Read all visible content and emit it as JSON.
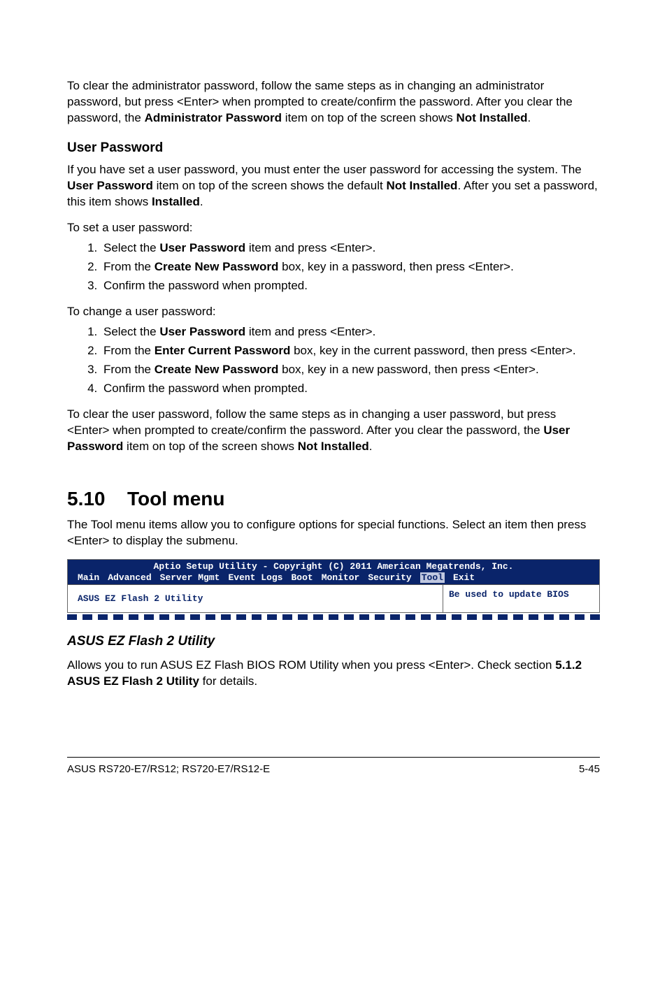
{
  "para1_a": "To clear the administrator password, follow the same steps as in changing an administrator password, but press <Enter> when prompted to create/confirm the password. After you clear the password, the ",
  "para1_b": "Administrator Password",
  "para1_c": " item on top of the screen shows ",
  "para1_d": "Not Installed",
  "para1_e": ".",
  "user_password_heading": "User Password",
  "para2_a": "If you have set a user password, you must enter the user password for accessing the system. The ",
  "para2_b": "User Password",
  "para2_c": " item on top of the screen shows the default ",
  "para2_d": "Not Installed",
  "para2_e": ". After you set a password, this item shows ",
  "para2_f": "Installed",
  "para2_g": ".",
  "lead_set": "To set a user password:",
  "set_li1_a": "Select the ",
  "set_li1_b": "User Password",
  "set_li1_c": " item and press <Enter>.",
  "set_li2_a": "From the ",
  "set_li2_b": "Create New Password",
  "set_li2_c": " box, key in a password, then press <Enter>.",
  "set_li3": "Confirm the password when prompted.",
  "lead_change": "To change a user password:",
  "chg_li1_a": "Select the ",
  "chg_li1_b": "User Password",
  "chg_li1_c": " item and press <Enter>.",
  "chg_li2_a": "From the ",
  "chg_li2_b": "Enter Current Password",
  "chg_li2_c": " box, key in the current password, then press <Enter>.",
  "chg_li3_a": "From the ",
  "chg_li3_b": "Create New Password",
  "chg_li3_c": " box, key in a new password, then press <Enter>.",
  "chg_li4": "Confirm the password when prompted.",
  "para3_a": "To clear the user password, follow the same steps as in changing a user password, but press <Enter> when prompted to create/confirm the password. After you clear the password, the ",
  "para3_b": "User Password",
  "para3_c": " item on top of the screen shows ",
  "para3_d": "Not Installed",
  "para3_e": ".",
  "h1_num": "5.10",
  "h1_text": "Tool menu",
  "para4": "The Tool menu items allow you to configure options for special functions. Select an item then press <Enter> to display the submenu.",
  "bios": {
    "header": "Aptio Setup Utility - Copyright (C) 2011 American Megatrends, Inc.",
    "tabs": [
      "Main",
      "Advanced",
      "Server Mgmt",
      "Event Logs",
      "Boot",
      "Monitor",
      "Security",
      "Tool",
      "Exit"
    ],
    "active_tab": "Tool",
    "left": "ASUS EZ Flash 2 Utility",
    "right": "Be used to update BIOS"
  },
  "h2i": "ASUS EZ Flash 2 Utility",
  "para5_a": "Allows you to run ASUS EZ Flash BIOS ROM Utility when you press <Enter>. Check section ",
  "para5_b": "5.1.2 ASUS EZ Flash 2 Utility",
  "para5_c": " for details.",
  "footer_left": "ASUS RS720-E7/RS12; RS720-E7/RS12-E",
  "footer_right": "5-45"
}
